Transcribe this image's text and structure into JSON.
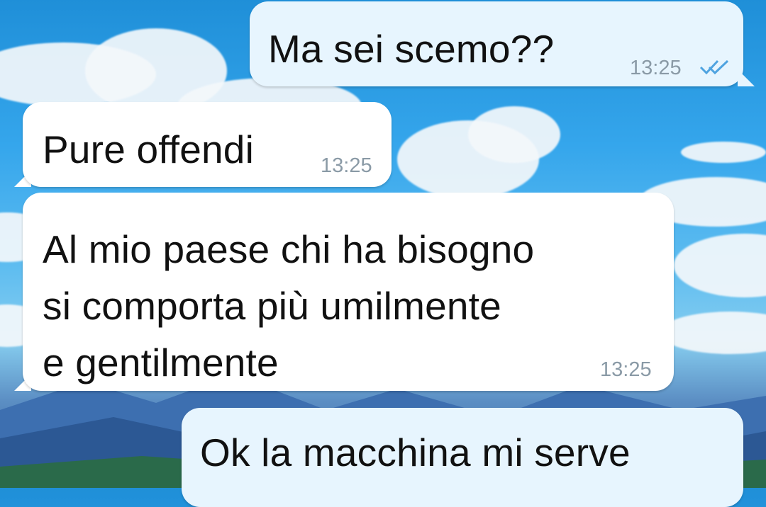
{
  "colors": {
    "outgoing_bubble": "#e7f5fe",
    "incoming_bubble": "#ffffff",
    "timestamp": "#8a9aa6",
    "read_ticks": "#4fa3e0"
  },
  "messages": [
    {
      "direction": "outgoing",
      "text": "Ma sei scemo??",
      "time": "13:25",
      "status_icon": "double-check-read-icon"
    },
    {
      "direction": "incoming",
      "text": "Pure offendi",
      "time": "13:25"
    },
    {
      "direction": "incoming",
      "text": "Al mio paese chi ha bisogno\nsi comporta più umilmente\ne gentilmente",
      "time": "13:25"
    },
    {
      "direction": "outgoing",
      "text": "Ok la macchina mi serve",
      "time": ""
    }
  ]
}
